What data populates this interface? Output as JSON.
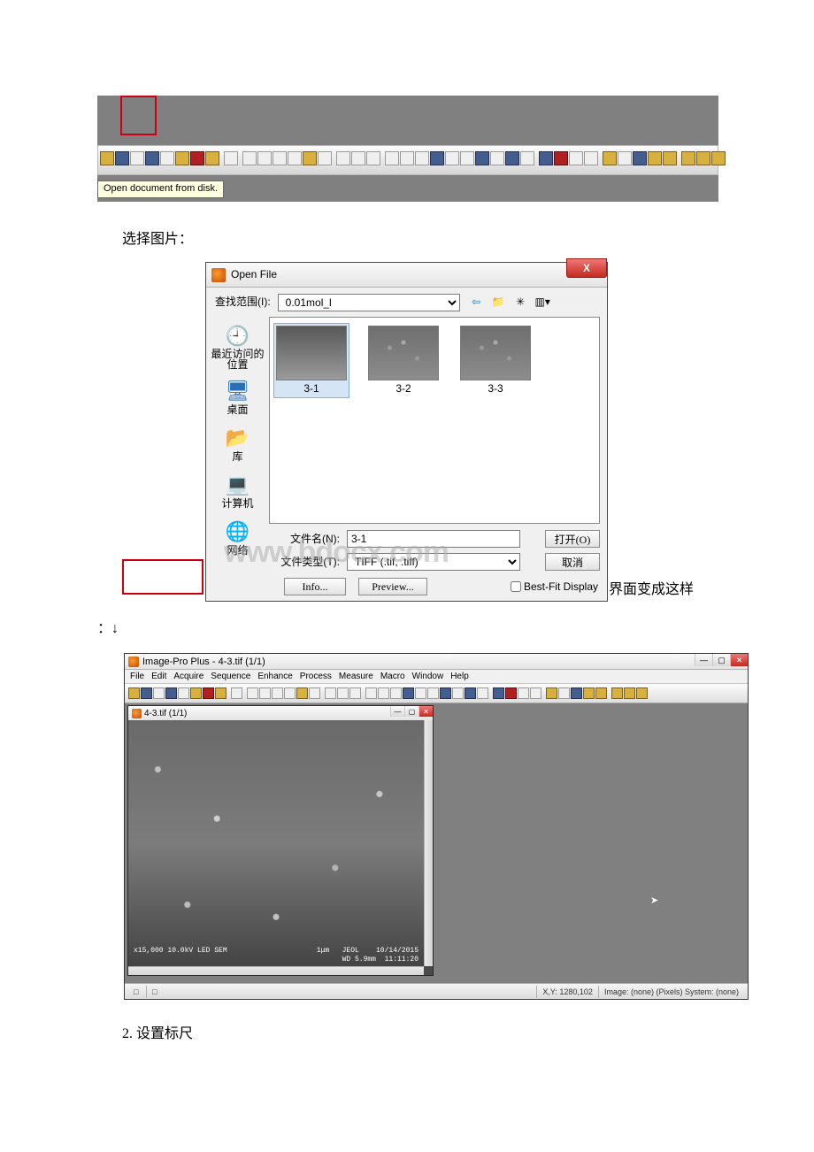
{
  "text": {
    "select_image": "选择图片：",
    "interface_becomes": "界面变成这样",
    "arrow_line": "：↓",
    "section2": "2. 设置标尺"
  },
  "fig1": {
    "tooltip": "Open document from disk."
  },
  "open_dialog": {
    "title": "Open File",
    "lookin_label": "查找范围(I):",
    "lookin_value": "0.01mol_l",
    "places": {
      "recent": "最近访问的位置",
      "desktop": "桌面",
      "library": "库",
      "computer": "计算机",
      "network": "网络"
    },
    "thumbs": [
      "3-1",
      "3-2",
      "3-3"
    ],
    "filename_label": "文件名(N):",
    "filename_value": "3-1",
    "filetype_label": "文件类型(T):",
    "filetype_value": "TIFF (.tif, .tiff)",
    "open_btn": "打开(O)",
    "cancel_btn": "取消",
    "info_btn": "Info...",
    "preview_btn": "Preview...",
    "bestfit_label": "Best-Fit Display",
    "watermark": "www.bdocx.com",
    "close_x": "X"
  },
  "ipp": {
    "title": "Image-Pro Plus - 4-3.tif (1/1)",
    "menu": [
      "File",
      "Edit",
      "Acquire",
      "Sequence",
      "Enhance",
      "Process",
      "Measure",
      "Macro",
      "Window",
      "Help"
    ],
    "doc_title": "4-3.tif (1/1)",
    "footer_left": "x15,000    10.0kV LED      SEM",
    "footer_right": "1μm   JEOL    10/14/2015\nWD 5.9mm  11:11:20",
    "status_xy": "X,Y: 1280,102",
    "status_right": "Image: (none) (Pixels) System: (none)"
  }
}
